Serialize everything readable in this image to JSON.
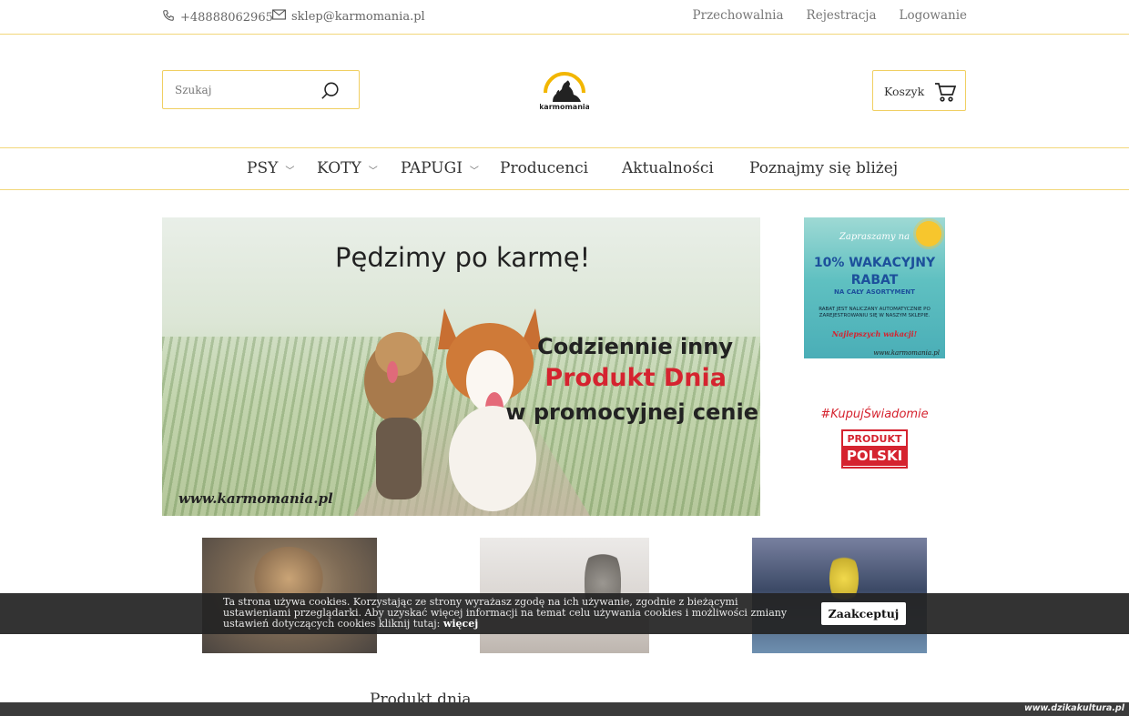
{
  "topbar": {
    "phone": "+48888062965",
    "email": "sklep@karmomania.pl",
    "links": [
      "Przechowalnia",
      "Rejestracja",
      "Logowanie"
    ]
  },
  "header": {
    "search_placeholder": "Szukaj",
    "logo_text": "karmomania",
    "cart_label": "Koszyk"
  },
  "nav": {
    "items": [
      "PSY",
      "KOTY",
      "PAPUGI",
      "Producenci",
      "Aktualności",
      "Poznajmy się bliżej"
    ]
  },
  "hero": {
    "title": "Pędzimy po karmę!",
    "line1": "Codziennie inny",
    "line2": "Produkt Dnia",
    "line3": "w promocyjnej cenie",
    "url": "www.karmomania.pl"
  },
  "promo": {
    "line1": "Zapraszamy na",
    "line2": "10% WAKACYJNY",
    "line3": "RABAT",
    "line4": "NA CAŁY ASORTYMENT",
    "line5": "RABAT JEST NALICZANY AUTOMATYCZNIE PO ZAREJESTROWANIU SIĘ W NASZYM SKLEPIE.",
    "line6": "Najlepszych wakacji!",
    "url": "www.karmomania.pl"
  },
  "badge": {
    "hashtag": "#KupujŚwiadomie",
    "top": "PRODUKT",
    "bottom": "POLSKI"
  },
  "cookie": {
    "text": "Ta strona używa cookies. Korzystając ze strony wyrażasz zgodę na ich używanie, zgodnie z bieżącymi ustawieniami przeglądarki. Aby uzyskać więcej informacji na temat celu używania cookies i możliwości zmiany ustawień dotyczących cookies kliknij tutaj:",
    "more": "więcej",
    "accept": "Zaakceptuj"
  },
  "section_title": "Produkt dnia",
  "watermark": "www.dzikakultura.pl",
  "colors": {
    "accent": "#f0cf62",
    "red": "#d5232f",
    "blue": "#1c4f9b"
  }
}
